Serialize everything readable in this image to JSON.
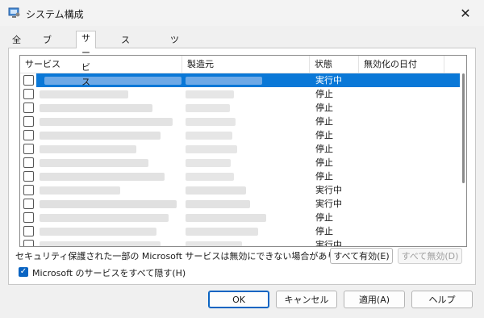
{
  "window": {
    "title": "システム構成",
    "close_glyph": "✕",
    "icon": "msconfig-icon"
  },
  "tabs": [
    {
      "label": "全般"
    },
    {
      "label": "ブート"
    },
    {
      "label": "サービス"
    },
    {
      "label": "スタートアップ"
    },
    {
      "label": "ツール"
    }
  ],
  "active_tab": "サービス",
  "services_table": {
    "columns": [
      "サービス",
      "製造元",
      "状態",
      "無効化の日付"
    ],
    "rows": [
      {
        "status": "実行中",
        "selected": true
      },
      {
        "status": "停止"
      },
      {
        "status": "停止"
      },
      {
        "status": "停止"
      },
      {
        "status": "停止"
      },
      {
        "status": "停止"
      },
      {
        "status": "停止"
      },
      {
        "status": "停止"
      },
      {
        "status": "実行中"
      },
      {
        "status": "実行中"
      },
      {
        "status": "停止"
      },
      {
        "status": "停止"
      },
      {
        "status": "実行中"
      }
    ]
  },
  "notice": "セキュリティ保護された一部の Microsoft サービスは無効にできない場合があります。",
  "buttons": {
    "enable_all": "すべて有効(E)",
    "disable_all": "すべて無効(D)",
    "ok": "OK",
    "cancel": "キャンセル",
    "apply": "適用(A)",
    "help": "ヘルプ"
  },
  "hide_ms": {
    "label": "Microsoft のサービスをすべて隠す(H)",
    "checked": true
  },
  "colors": {
    "selection": "#0a78d7",
    "accent": "#0a64c2"
  }
}
